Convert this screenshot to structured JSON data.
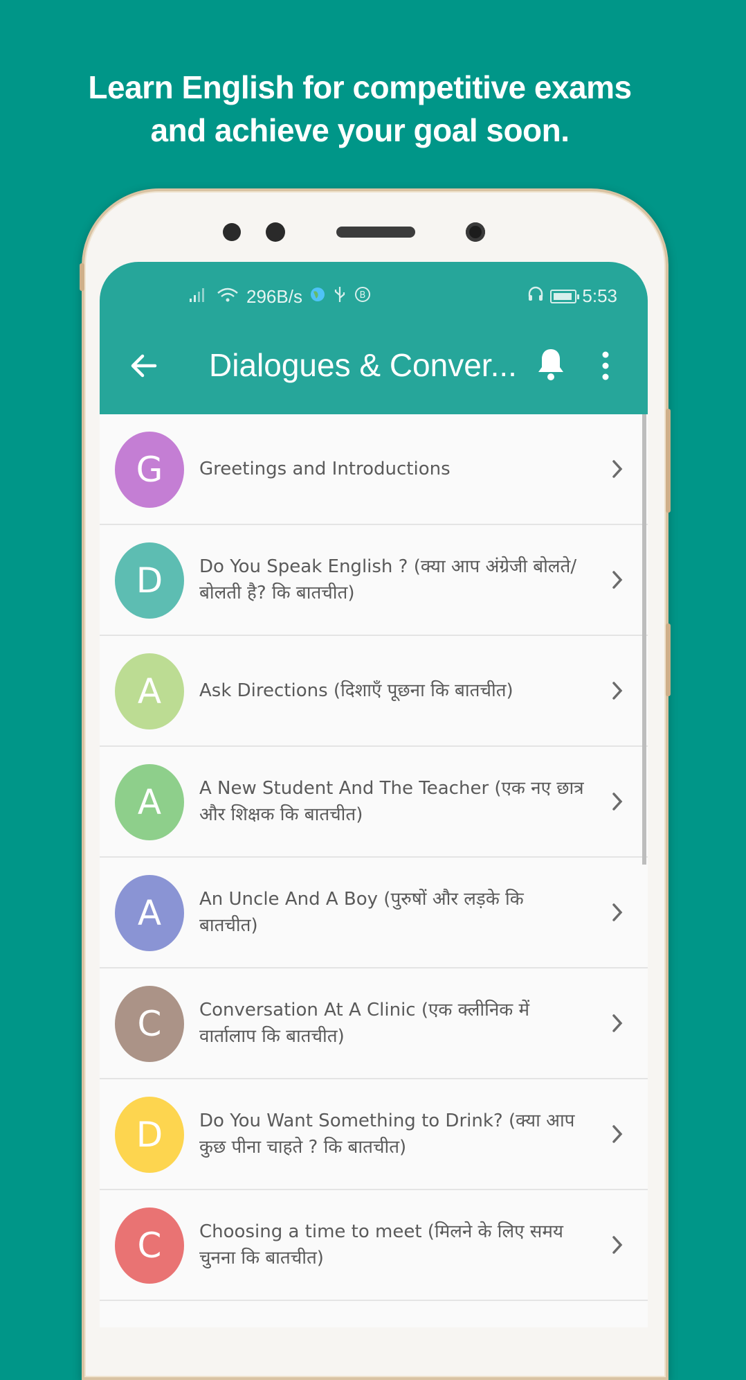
{
  "colors": {
    "background": "#009688",
    "appbar": "#26a69a",
    "avatars": [
      "#c47ed4",
      "#5dbdb2",
      "#bcdc93",
      "#8ecf8b",
      "#8a94d4",
      "#ab9387",
      "#fdd54f",
      "#e97373"
    ]
  },
  "promo": {
    "line1": "Learn English for competitive exams",
    "line2": "and achieve your goal soon."
  },
  "statusbar": {
    "speed": "296B/s",
    "time": "5:53"
  },
  "toolbar": {
    "title": "Dialogues & Conver..."
  },
  "icons": {
    "back": "arrow-back-icon",
    "bell": "bell-icon",
    "more": "more-vert-icon",
    "chevron": "chevron-right-icon"
  },
  "list": {
    "items": [
      {
        "letter": "G",
        "title": "Greetings and Introductions"
      },
      {
        "letter": "D",
        "title": "Do You Speak English ? (क्या आप अंग्रेजी बोलते/बोलती है? कि बातचीत)"
      },
      {
        "letter": "A",
        "title": "Ask Directions (दिशाएँ पूछना कि बातचीत)"
      },
      {
        "letter": "A",
        "title": "A New Student And The Teacher (एक नए छात्र और शिक्षक कि बातचीत)"
      },
      {
        "letter": "A",
        "title": "An Uncle And A Boy (पुरुषों और लड़के कि बातचीत)"
      },
      {
        "letter": "C",
        "title": "Conversation At A Clinic (एक क्लीनिक में वार्तालाप कि बातचीत)"
      },
      {
        "letter": "D",
        "title": "Do You Want Something to Drink? (क्या आप कुछ पीना चाहते ? कि बातचीत)"
      },
      {
        "letter": "C",
        "title": "Choosing a time to meet (मिलने के लिए समय चुनना कि बातचीत)"
      }
    ]
  }
}
